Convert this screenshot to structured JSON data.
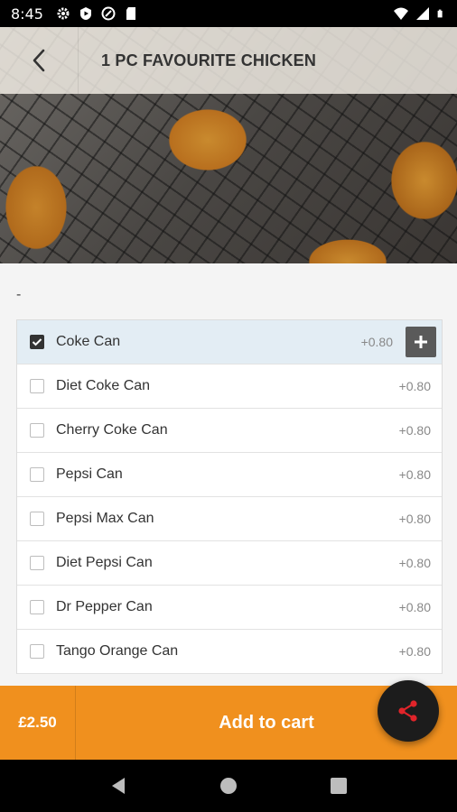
{
  "status_bar": {
    "time": "8:45",
    "left_icons": [
      "gear-icon",
      "play-protect-icon",
      "vpn-icon",
      "sd-card-icon"
    ],
    "right_icons": [
      "wifi-icon",
      "signal-icon",
      "battery-icon"
    ]
  },
  "header": {
    "title": "1 PC FAVOURITE CHICKEN",
    "back_icon": "chevron-left-icon"
  },
  "section": {
    "label": "-"
  },
  "options": [
    {
      "label": "Coke Can",
      "price": "+0.80",
      "checked": true
    },
    {
      "label": "Diet Coke Can",
      "price": "+0.80",
      "checked": false
    },
    {
      "label": "Cherry Coke Can",
      "price": "+0.80",
      "checked": false
    },
    {
      "label": "Pepsi Can",
      "price": "+0.80",
      "checked": false
    },
    {
      "label": "Pepsi Max Can",
      "price": "+0.80",
      "checked": false
    },
    {
      "label": "Diet Pepsi Can",
      "price": "+0.80",
      "checked": false
    },
    {
      "label": "Dr Pepper Can",
      "price": "+0.80",
      "checked": false
    },
    {
      "label": "Tango Orange Can",
      "price": "+0.80",
      "checked": false
    }
  ],
  "cart": {
    "total": "£2.50",
    "add_label": "Add to cart"
  },
  "colors": {
    "accent": "#f0901e",
    "share_icon": "#e0242a",
    "selected_row": "#e3edf4"
  }
}
